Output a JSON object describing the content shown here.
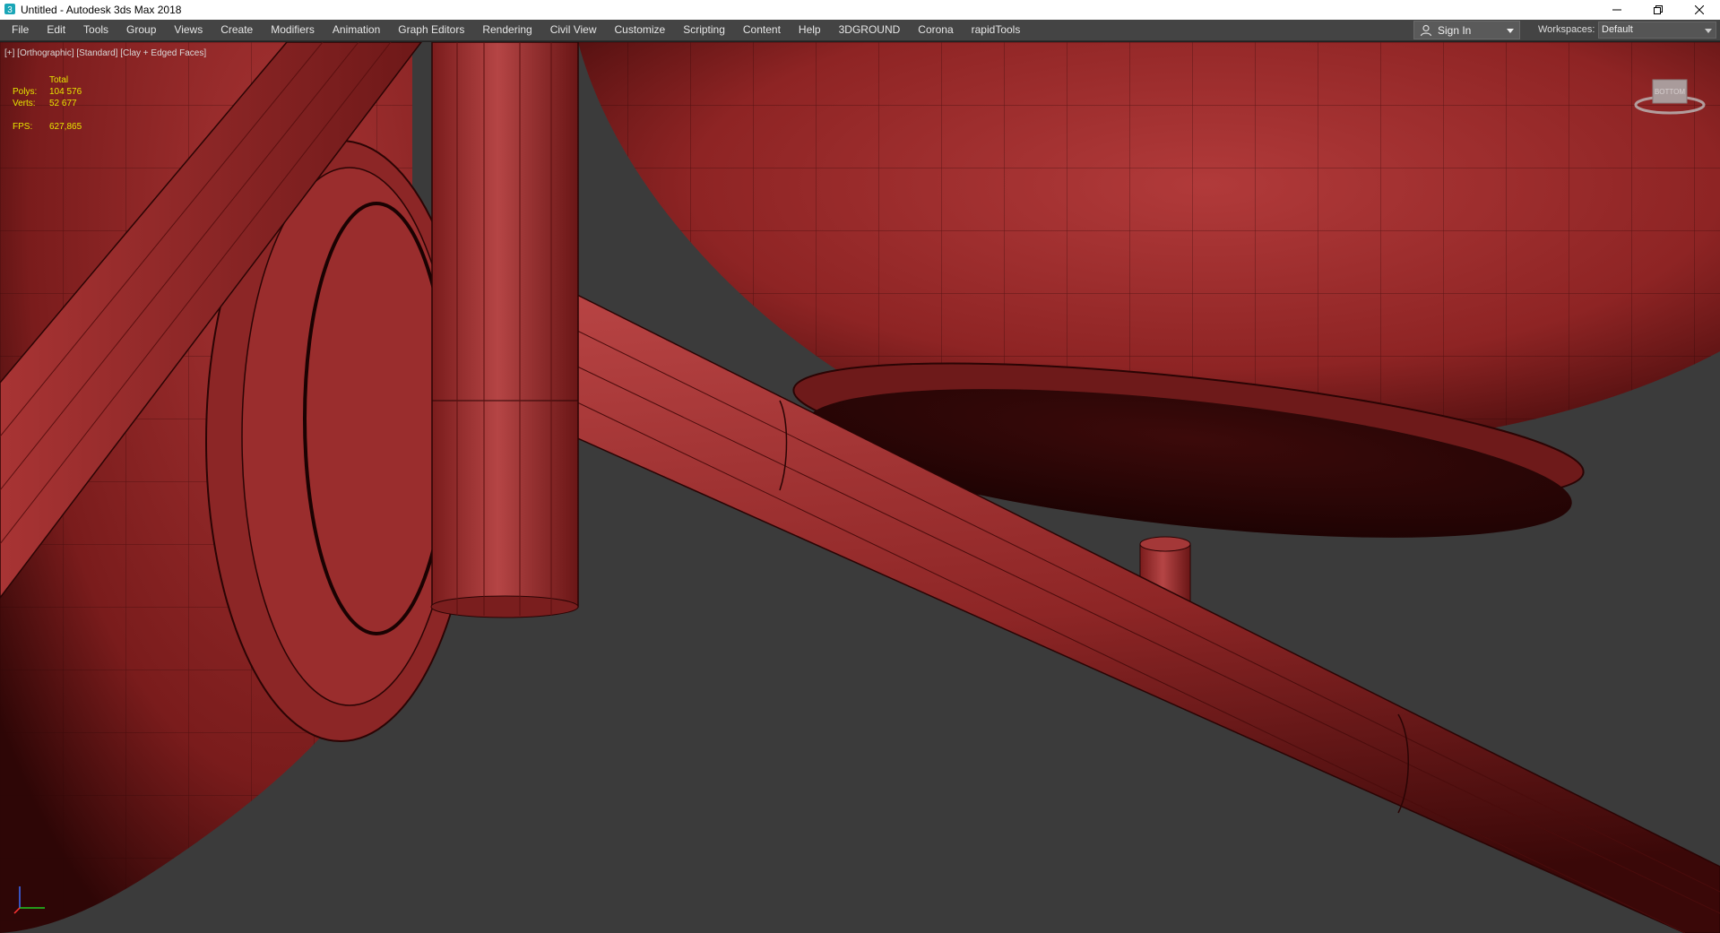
{
  "window": {
    "title": "Untitled - Autodesk 3ds Max 2018"
  },
  "menu": {
    "items": [
      "File",
      "Edit",
      "Tools",
      "Group",
      "Views",
      "Create",
      "Modifiers",
      "Animation",
      "Graph Editors",
      "Rendering",
      "Civil View",
      "Customize",
      "Scripting",
      "Content",
      "Help",
      "3DGROUND",
      "Corona",
      "rapidTools"
    ]
  },
  "account": {
    "sign_in_label": "Sign In"
  },
  "workspaces": {
    "label": "Workspaces:",
    "value": "Default"
  },
  "viewport": {
    "label": "[+] [Orthographic] [Standard] [Clay + Edged Faces]",
    "stats": {
      "header": "Total",
      "polys_label": "Polys:",
      "polys_value": "104 576",
      "verts_label": "Verts:",
      "verts_value": "52 677",
      "fps_label": "FPS:",
      "fps_value": "627,865"
    },
    "viewcube_label": "BOTTOM"
  },
  "colors": {
    "clay": "#9a2a2a",
    "clay_dark": "#4a0c0c",
    "background": "#3b3b3b",
    "stats_text": "#e6e600"
  },
  "icons": {
    "app": "3dsmax-icon",
    "minimize": "minimize-icon",
    "maximize": "restore-icon",
    "close": "close-icon",
    "user": "user-icon",
    "dropdown": "chevron-down-icon"
  }
}
